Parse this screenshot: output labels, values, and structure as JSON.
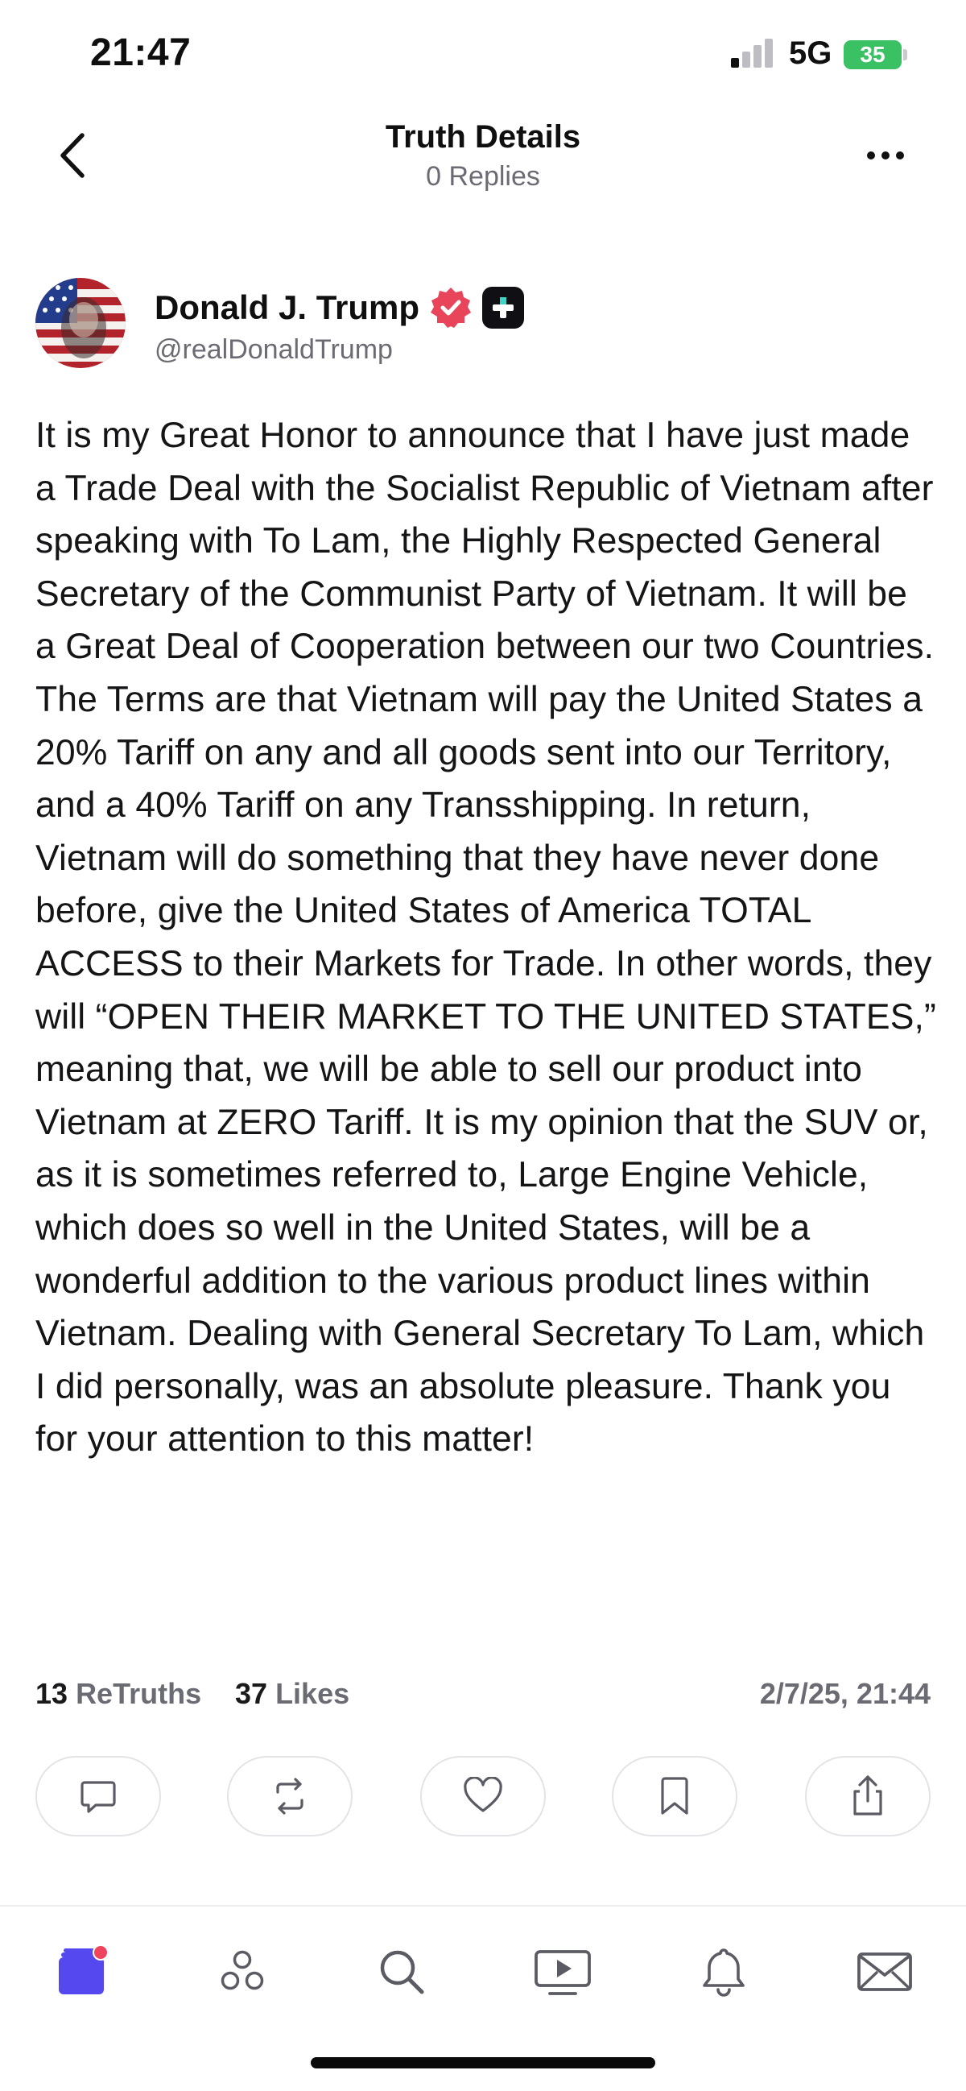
{
  "status_bar": {
    "time": "21:47",
    "network": "5G",
    "battery": "35"
  },
  "header": {
    "title": "Truth Details",
    "subtitle": "0 Replies",
    "back_icon": "chevron-left-icon",
    "more_icon": "more-horizontal-icon"
  },
  "author": {
    "name": "Donald J. Trump",
    "handle": "@realDonaldTrump",
    "verified_badge_color": "#e8455a",
    "plus_badge_color": "#101014"
  },
  "post": {
    "body": "It is my Great Honor to announce that I have just made a Trade Deal with the Socialist Republic of Vietnam after speaking with To Lam, the Highly Respected General Secretary of the Communist Party of Vietnam. It will be a Great Deal of Cooperation between our two Countries. The Terms are that Vietnam will pay the United States a 20% Tariff on any and all goods sent into our Territory, and a 40% Tariff on any Transshipping. In return, Vietnam will do something that they have never done before, give the United States of America TOTAL ACCESS to their Markets for Trade. In other words, they will “OPEN THEIR MARKET TO THE UNITED STATES,” meaning that, we will be able to sell our product into Vietnam at ZERO Tariff. It is my opinion that the SUV or, as it is sometimes referred to, Large Engine Vehicle, which does so well in the United States, will be a wonderful addition to the various product lines within Vietnam. Dealing with General Secretary To Lam, which I did personally, was an absolute pleasure. Thank you for your attention to this matter!",
    "retruths_count": "13",
    "retruths_label": "ReTruths",
    "likes_count": "37",
    "likes_label": "Likes",
    "timestamp": "2/7/25, 21:44"
  },
  "actions": [
    {
      "icon": "reply-icon"
    },
    {
      "icon": "retruth-icon"
    },
    {
      "icon": "heart-icon"
    },
    {
      "icon": "bookmark-icon"
    },
    {
      "icon": "share-icon"
    }
  ],
  "bottom_nav": [
    {
      "icon": "home-feed-icon",
      "active": true,
      "accent": "#5448ee",
      "notification_color": "#f0435c"
    },
    {
      "icon": "groups-icon"
    },
    {
      "icon": "search-icon"
    },
    {
      "icon": "video-icon"
    },
    {
      "icon": "bell-icon"
    },
    {
      "icon": "mail-icon"
    }
  ]
}
